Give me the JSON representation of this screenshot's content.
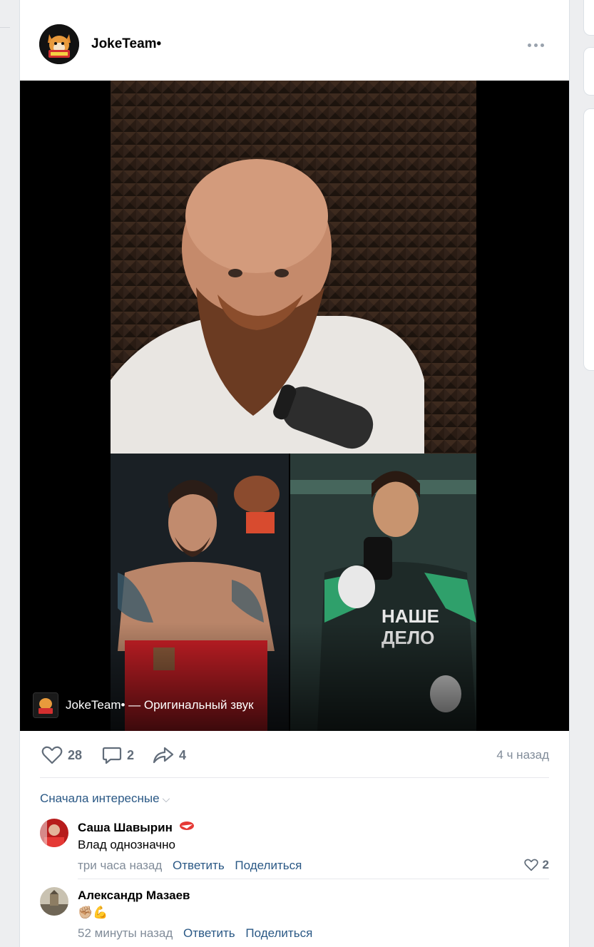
{
  "post": {
    "author": "JokeTeam•",
    "media_caption": "JokeTeam• — Оригинальный звук",
    "likes": "28",
    "comments": "2",
    "shares": "4",
    "timestamp": "4 ч назад"
  },
  "comments_section": {
    "sort_label": "Сначала интересные",
    "items": [
      {
        "author": "Саша Шавырин",
        "text": "Влад однозначно",
        "time": "три часа назад",
        "reply": "Ответить",
        "share": "Поделиться",
        "likes": "2"
      },
      {
        "author": "Александр Мазаев",
        "text": "✊🏼💪",
        "time": "52 минуты назад",
        "reply": "Ответить",
        "share": "Поделиться"
      }
    ]
  },
  "colors": {
    "link": "#2a5885",
    "muted": "#818c99",
    "background": "#edeef0"
  },
  "icons": [
    "more-icon",
    "like-icon",
    "comment-icon",
    "share-icon",
    "chevron-down-icon",
    "spartak-badge-icon"
  ]
}
